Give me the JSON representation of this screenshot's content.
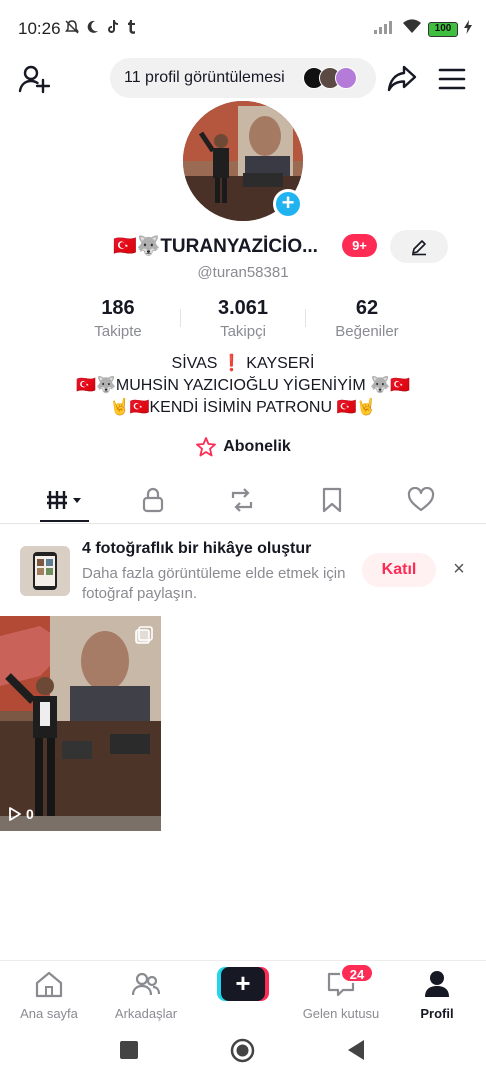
{
  "status_bar": {
    "time": "10:26",
    "left_icons": [
      "bell-off-icon",
      "moon-icon",
      "tiktok-icon",
      "tumblr-icon"
    ],
    "battery": "100"
  },
  "top_bar": {
    "profile_views": "11 profil görüntülemesi",
    "viewer_avatar_colors": [
      "#111111",
      "#5b4a44",
      "#b57bd8"
    ]
  },
  "profile": {
    "display_name": "🇹🇷🐺TURANYAZİCİO...",
    "notification_badge": "9+",
    "handle": "@turan58381",
    "stats": [
      {
        "value": "186",
        "label": "Takipte"
      },
      {
        "value": "3.061",
        "label": "Takipçi"
      },
      {
        "value": "62",
        "label": "Beğeniler"
      }
    ],
    "bio_lines": [
      "SİVAS ❗ KAYSERİ",
      "🇹🇷🐺MUHSİN YAZICIOĞLU YİGENİYİM 🐺🇹🇷",
      "🤘🇹🇷KENDİ İSİMİN PATRONU 🇹🇷🤘"
    ],
    "subscription_label": "Abonelik"
  },
  "tabs": [
    "videos-tab",
    "private-tab",
    "reposts-tab",
    "favorites-tab",
    "liked-tab"
  ],
  "story_prompt": {
    "title": "4 fotoğraflık bir hikâye oluştur",
    "subtitle": "Daha fazla görüntüleme elde etmek için fotoğraf paylaşın.",
    "join_label": "Katıl",
    "close": "×"
  },
  "videos": [
    {
      "play_count": "0"
    }
  ],
  "bottom_nav": {
    "home": "Ana sayfa",
    "friends": "Arkadaşlar",
    "create": "+",
    "inbox": "Gelen kutusu",
    "inbox_badge": "24",
    "profile": "Profil"
  },
  "colors": {
    "accent": "#fe2c55",
    "cyan": "#20d5ec",
    "text": "#161823",
    "muted": "#8a8b91"
  }
}
